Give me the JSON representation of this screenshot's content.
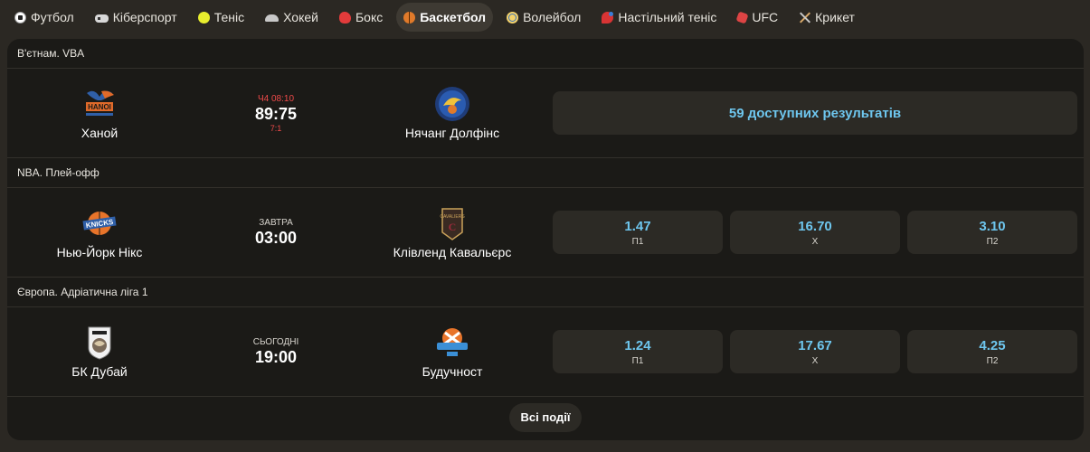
{
  "tabs": [
    {
      "label": "Футбол",
      "icon": "football-icon",
      "active": false
    },
    {
      "label": "Кіберспорт",
      "icon": "gamepad-icon",
      "active": false
    },
    {
      "label": "Теніс",
      "icon": "tennis-ball-icon",
      "active": false
    },
    {
      "label": "Хокей",
      "icon": "hockey-helmet-icon",
      "active": false
    },
    {
      "label": "Бокс",
      "icon": "boxing-glove-icon",
      "active": false
    },
    {
      "label": "Баскетбол",
      "icon": "basketball-icon",
      "active": true
    },
    {
      "label": "Волейбол",
      "icon": "volleyball-icon",
      "active": false
    },
    {
      "label": "Настільний теніс",
      "icon": "table-tennis-icon",
      "active": false
    },
    {
      "label": "UFC",
      "icon": "ufc-glove-icon",
      "active": false
    },
    {
      "label": "Крикет",
      "icon": "cricket-bats-icon",
      "active": false
    }
  ],
  "events": [
    {
      "league": "В'єтнам. VBA",
      "home": {
        "name": "Ханой",
        "logo": "hanoi-logo-icon"
      },
      "away": {
        "name": "Нячанг Долфінс",
        "logo": "nha-trang-dolphins-logo-icon"
      },
      "status": {
        "top": "Ч4 08:10",
        "main": "89:75",
        "sub": "7:1",
        "live": true
      },
      "results_label": "59 доступних результатів"
    },
    {
      "league": "NBA. Плей-офф",
      "home": {
        "name": "Нью-Йорк Нікс",
        "logo": "knicks-logo-icon"
      },
      "away": {
        "name": "Клівленд Кавальєрс",
        "logo": "cavaliers-logo-icon"
      },
      "status": {
        "top": "ЗАВТРА",
        "main": "03:00",
        "live": false
      },
      "odds": [
        {
          "value": "1.47",
          "label": "П1"
        },
        {
          "value": "16.70",
          "label": "Х"
        },
        {
          "value": "3.10",
          "label": "П2"
        }
      ]
    },
    {
      "league": "Європа. Адріатична ліга 1",
      "home": {
        "name": "БК Дубай",
        "logo": "bc-dubai-logo-icon"
      },
      "away": {
        "name": "Будучност",
        "logo": "buducnost-logo-icon"
      },
      "status": {
        "top": "СЬОГОДНІ",
        "main": "19:00",
        "live": false
      },
      "odds": [
        {
          "value": "1.24",
          "label": "П1"
        },
        {
          "value": "17.67",
          "label": "Х"
        },
        {
          "value": "4.25",
          "label": "П2"
        }
      ]
    }
  ],
  "all_events_label": "Всі події",
  "colors": {
    "accent": "#6ec6ee",
    "live": "#ef4a4a",
    "card": "#1b1a17",
    "tile": "#2c2a25",
    "page": "#2b2823"
  }
}
